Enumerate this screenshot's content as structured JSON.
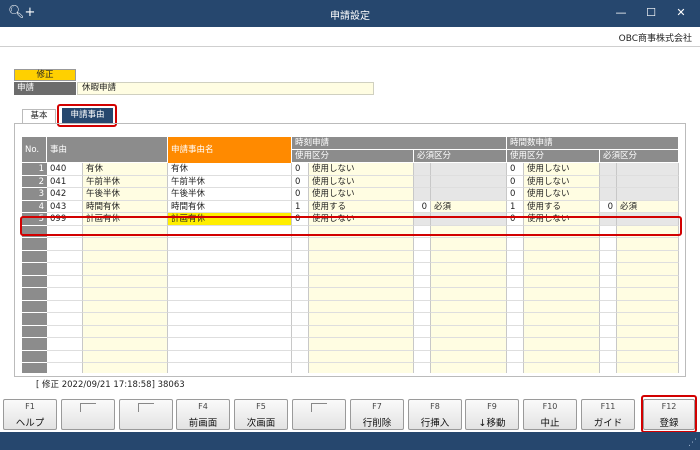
{
  "window": {
    "title": "申請設定",
    "app_icon": "search-plus-icon"
  },
  "company": "OBC商事株式会社",
  "status_tag": "修正",
  "request": {
    "label": "申請",
    "value": "休暇申請"
  },
  "tabs": [
    {
      "label": "基本"
    },
    {
      "label": "申請事由",
      "active": true
    }
  ],
  "table": {
    "headers": {
      "no": "No.",
      "reason": "事由",
      "reason_name": "申請事由名",
      "time_request": "時刻申請",
      "hours_request": "時間数申請",
      "usage": "使用区分",
      "required": "必須区分"
    },
    "rows": [
      {
        "no": "1",
        "code": "040",
        "reason": "有休",
        "name": "有休",
        "t_use_code": "0",
        "t_use": "使用しない",
        "t_req_code": "",
        "t_req": "",
        "h_use_code": "0",
        "h_use": "使用しない",
        "h_req_code": "",
        "h_req": ""
      },
      {
        "no": "2",
        "code": "041",
        "reason": "午前半休",
        "name": "午前半休",
        "t_use_code": "0",
        "t_use": "使用しない",
        "t_req_code": "",
        "t_req": "",
        "h_use_code": "0",
        "h_use": "使用しない",
        "h_req_code": "",
        "h_req": ""
      },
      {
        "no": "3",
        "code": "042",
        "reason": "午後半休",
        "name": "午後半休",
        "t_use_code": "0",
        "t_use": "使用しない",
        "t_req_code": "",
        "t_req": "",
        "h_use_code": "0",
        "h_use": "使用しない",
        "h_req_code": "",
        "h_req": ""
      },
      {
        "no": "4",
        "code": "043",
        "reason": "時間有休",
        "name": "時間有休",
        "t_use_code": "1",
        "t_use": "使用する",
        "t_req_code": "0",
        "t_req": "必須",
        "h_use_code": "1",
        "h_use": "使用する",
        "h_req_code": "0",
        "h_req": "必須"
      },
      {
        "no": "5",
        "code": "099",
        "reason": "計画有休",
        "name": "計画有休",
        "t_use_code": "0",
        "t_use": "使用しない",
        "t_req_code": "",
        "t_req": "",
        "h_use_code": "0",
        "h_use": "使用しない",
        "h_req_code": "",
        "h_req": ""
      }
    ]
  },
  "modified_info": "[ 修正  2022/09/21 17:18:58]  38063",
  "function_keys": [
    {
      "key": "F1",
      "label": "ヘルプ"
    },
    {
      "key": "",
      "label": ""
    },
    {
      "key": "",
      "label": ""
    },
    {
      "key": "F4",
      "label": "前画面"
    },
    {
      "key": "F5",
      "label": "次画面"
    },
    {
      "key": "",
      "label": ""
    },
    {
      "key": "F7",
      "label": "行削除"
    },
    {
      "key": "F8",
      "label": "行挿入"
    },
    {
      "key": "F9",
      "label": "↓移動"
    },
    {
      "key": "F10",
      "label": "中止"
    },
    {
      "key": "F11",
      "label": "ガイド"
    },
    {
      "key": "F12",
      "label": "登録"
    }
  ],
  "colors": {
    "title_bar": "#26476e",
    "header_gray": "#8c8c8c",
    "highlight_orange": "#ff8a00",
    "input_yellow": "#fffde2",
    "selected_yellow": "#ffee00",
    "annotation_red": "#d20000"
  }
}
